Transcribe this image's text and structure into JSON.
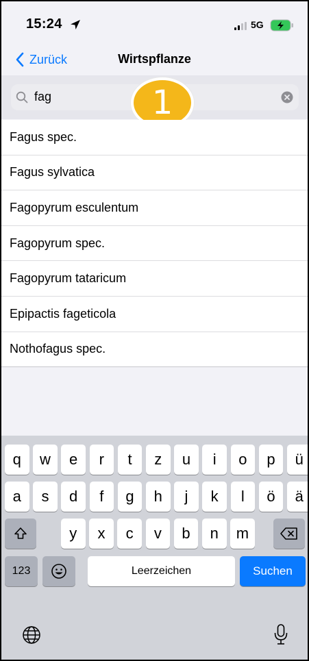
{
  "status": {
    "time": "15:24",
    "network": "5G"
  },
  "nav": {
    "back_label": "Zurück",
    "title": "Wirtspflanze"
  },
  "search": {
    "query": "fag"
  },
  "badge": {
    "number": "1"
  },
  "results": [
    "Fagus spec.",
    "Fagus sylvatica",
    "Fagopyrum esculentum",
    "Fagopyrum spec.",
    "Fagopyrum tataricum",
    "Epipactis fageticola",
    "Nothofagus spec."
  ],
  "keyboard": {
    "row1": [
      "q",
      "w",
      "e",
      "r",
      "t",
      "z",
      "u",
      "i",
      "o",
      "p",
      "ü"
    ],
    "row2": [
      "a",
      "s",
      "d",
      "f",
      "g",
      "h",
      "j",
      "k",
      "l",
      "ö",
      "ä"
    ],
    "row3": [
      "y",
      "x",
      "c",
      "v",
      "b",
      "n",
      "m"
    ],
    "numbers_label": "123",
    "space_label": "Leerzeichen",
    "action_label": "Suchen",
    "icons": {
      "shift": "shift-icon",
      "delete": "delete-icon",
      "emoji": "emoji-icon",
      "globe": "globe-icon",
      "mic": "microphone-icon"
    }
  },
  "colors": {
    "accent": "#0a7aff",
    "badge": "#f4b71a"
  }
}
